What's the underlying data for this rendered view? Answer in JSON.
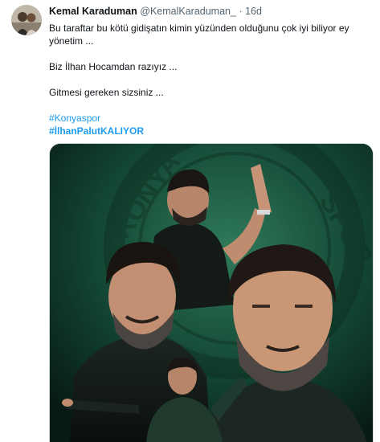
{
  "tweet": {
    "author_name": "Kemal Karaduman",
    "handle": "@KemalKaraduman_",
    "separator": "·",
    "timestamp": "16d",
    "lines": [
      "Bu taraftar bu kötü gidişatın kimin yüzünden  olduğunu çok iyi biliyor ey yönetim ...",
      "Biz İlhan Hocamdan razıyız ...",
      "Gitmesi gereken sizsiniz ..."
    ],
    "hashtags": [
      "#Konyaspor",
      "#İlhanPalutKALIYOR"
    ],
    "media": {
      "watermark": "KONYASPOR"
    }
  },
  "colors": {
    "link": "#1d9bf0",
    "secondary_text": "#536471",
    "media_bg": "#0c2a20"
  }
}
